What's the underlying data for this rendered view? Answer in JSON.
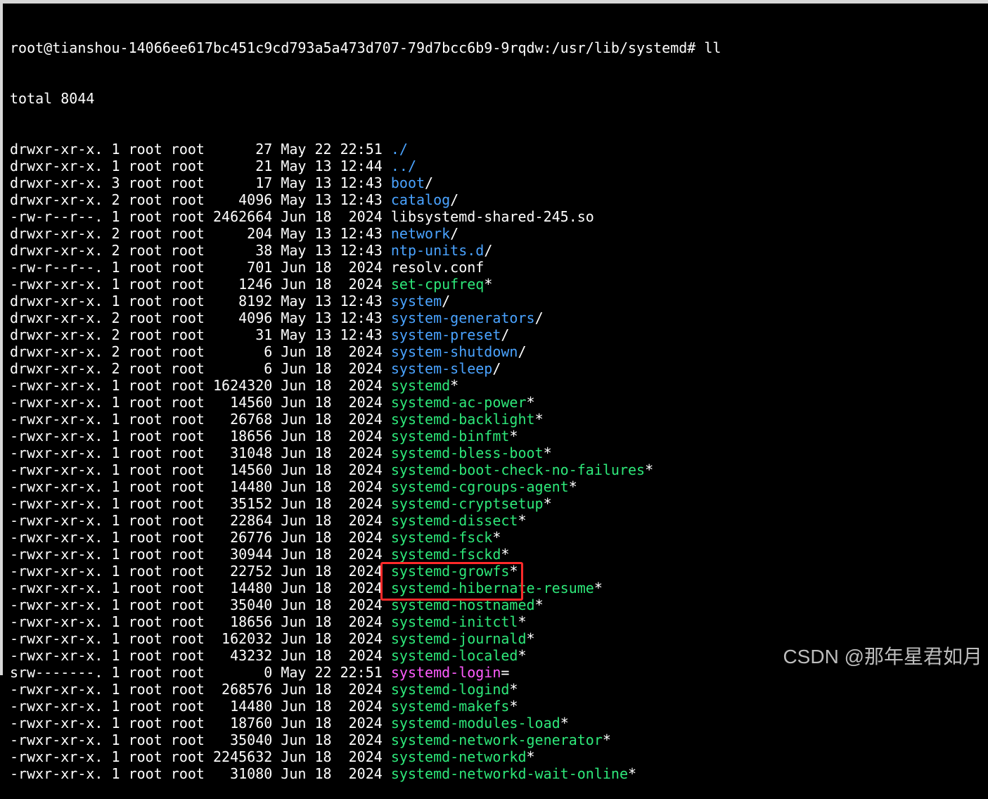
{
  "terminal": {
    "prompt": "root@tianshou-14066ee617bc451c9cd793a5a473d707-79d7bcc6b9-9rqdw:/usr/lib/systemd# ll",
    "total": "total 8044",
    "rows": [
      {
        "perms": "drwxr-xr-x.",
        "links": "1",
        "owner": "root",
        "group": "root",
        "size": "27",
        "month": "May",
        "day": "22",
        "time": "22:51",
        "name": "./",
        "type": "dir",
        "suffix": ""
      },
      {
        "perms": "drwxr-xr-x.",
        "links": "1",
        "owner": "root",
        "group": "root",
        "size": "21",
        "month": "May",
        "day": "13",
        "time": "12:44",
        "name": "../",
        "type": "dir",
        "suffix": ""
      },
      {
        "perms": "drwxr-xr-x.",
        "links": "3",
        "owner": "root",
        "group": "root",
        "size": "17",
        "month": "May",
        "day": "13",
        "time": "12:43",
        "name": "boot",
        "type": "dir",
        "suffix": "/"
      },
      {
        "perms": "drwxr-xr-x.",
        "links": "2",
        "owner": "root",
        "group": "root",
        "size": "4096",
        "month": "May",
        "day": "13",
        "time": "12:43",
        "name": "catalog",
        "type": "dir",
        "suffix": "/"
      },
      {
        "perms": "-rw-r--r--.",
        "links": "1",
        "owner": "root",
        "group": "root",
        "size": "2462664",
        "month": "Jun",
        "day": "18",
        "time": "2024",
        "name": "libsystemd-shared-245.so",
        "type": "plain",
        "suffix": ""
      },
      {
        "perms": "drwxr-xr-x.",
        "links": "2",
        "owner": "root",
        "group": "root",
        "size": "204",
        "month": "May",
        "day": "13",
        "time": "12:43",
        "name": "network",
        "type": "dir",
        "suffix": "/"
      },
      {
        "perms": "drwxr-xr-x.",
        "links": "2",
        "owner": "root",
        "group": "root",
        "size": "38",
        "month": "May",
        "day": "13",
        "time": "12:43",
        "name": "ntp-units.d",
        "type": "dir",
        "suffix": "/"
      },
      {
        "perms": "-rw-r--r--.",
        "links": "1",
        "owner": "root",
        "group": "root",
        "size": "701",
        "month": "Jun",
        "day": "18",
        "time": "2024",
        "name": "resolv.conf",
        "type": "plain",
        "suffix": ""
      },
      {
        "perms": "-rwxr-xr-x.",
        "links": "1",
        "owner": "root",
        "group": "root",
        "size": "1246",
        "month": "Jun",
        "day": "18",
        "time": "2024",
        "name": "set-cpufreq",
        "type": "exec",
        "suffix": "*"
      },
      {
        "perms": "drwxr-xr-x.",
        "links": "1",
        "owner": "root",
        "group": "root",
        "size": "8192",
        "month": "May",
        "day": "13",
        "time": "12:43",
        "name": "system",
        "type": "dir",
        "suffix": "/"
      },
      {
        "perms": "drwxr-xr-x.",
        "links": "2",
        "owner": "root",
        "group": "root",
        "size": "4096",
        "month": "May",
        "day": "13",
        "time": "12:43",
        "name": "system-generators",
        "type": "dir",
        "suffix": "/"
      },
      {
        "perms": "drwxr-xr-x.",
        "links": "2",
        "owner": "root",
        "group": "root",
        "size": "31",
        "month": "May",
        "day": "13",
        "time": "12:43",
        "name": "system-preset",
        "type": "dir",
        "suffix": "/"
      },
      {
        "perms": "drwxr-xr-x.",
        "links": "2",
        "owner": "root",
        "group": "root",
        "size": "6",
        "month": "Jun",
        "day": "18",
        "time": "2024",
        "name": "system-shutdown",
        "type": "dir",
        "suffix": "/"
      },
      {
        "perms": "drwxr-xr-x.",
        "links": "2",
        "owner": "root",
        "group": "root",
        "size": "6",
        "month": "Jun",
        "day": "18",
        "time": "2024",
        "name": "system-sleep",
        "type": "dir",
        "suffix": "/"
      },
      {
        "perms": "-rwxr-xr-x.",
        "links": "1",
        "owner": "root",
        "group": "root",
        "size": "1624320",
        "month": "Jun",
        "day": "18",
        "time": "2024",
        "name": "systemd",
        "type": "exec",
        "suffix": "*"
      },
      {
        "perms": "-rwxr-xr-x.",
        "links": "1",
        "owner": "root",
        "group": "root",
        "size": "14560",
        "month": "Jun",
        "day": "18",
        "time": "2024",
        "name": "systemd-ac-power",
        "type": "exec",
        "suffix": "*"
      },
      {
        "perms": "-rwxr-xr-x.",
        "links": "1",
        "owner": "root",
        "group": "root",
        "size": "26768",
        "month": "Jun",
        "day": "18",
        "time": "2024",
        "name": "systemd-backlight",
        "type": "exec",
        "suffix": "*"
      },
      {
        "perms": "-rwxr-xr-x.",
        "links": "1",
        "owner": "root",
        "group": "root",
        "size": "18656",
        "month": "Jun",
        "day": "18",
        "time": "2024",
        "name": "systemd-binfmt",
        "type": "exec",
        "suffix": "*"
      },
      {
        "perms": "-rwxr-xr-x.",
        "links": "1",
        "owner": "root",
        "group": "root",
        "size": "31048",
        "month": "Jun",
        "day": "18",
        "time": "2024",
        "name": "systemd-bless-boot",
        "type": "exec",
        "suffix": "*"
      },
      {
        "perms": "-rwxr-xr-x.",
        "links": "1",
        "owner": "root",
        "group": "root",
        "size": "14560",
        "month": "Jun",
        "day": "18",
        "time": "2024",
        "name": "systemd-boot-check-no-failures",
        "type": "exec",
        "suffix": "*"
      },
      {
        "perms": "-rwxr-xr-x.",
        "links": "1",
        "owner": "root",
        "group": "root",
        "size": "14480",
        "month": "Jun",
        "day": "18",
        "time": "2024",
        "name": "systemd-cgroups-agent",
        "type": "exec",
        "suffix": "*"
      },
      {
        "perms": "-rwxr-xr-x.",
        "links": "1",
        "owner": "root",
        "group": "root",
        "size": "35152",
        "month": "Jun",
        "day": "18",
        "time": "2024",
        "name": "systemd-cryptsetup",
        "type": "exec",
        "suffix": "*"
      },
      {
        "perms": "-rwxr-xr-x.",
        "links": "1",
        "owner": "root",
        "group": "root",
        "size": "22864",
        "month": "Jun",
        "day": "18",
        "time": "2024",
        "name": "systemd-dissect",
        "type": "exec",
        "suffix": "*"
      },
      {
        "perms": "-rwxr-xr-x.",
        "links": "1",
        "owner": "root",
        "group": "root",
        "size": "26776",
        "month": "Jun",
        "day": "18",
        "time": "2024",
        "name": "systemd-fsck",
        "type": "exec",
        "suffix": "*"
      },
      {
        "perms": "-rwxr-xr-x.",
        "links": "1",
        "owner": "root",
        "group": "root",
        "size": "30944",
        "month": "Jun",
        "day": "18",
        "time": "2024",
        "name": "systemd-fsckd",
        "type": "exec",
        "suffix": "*"
      },
      {
        "perms": "-rwxr-xr-x.",
        "links": "1",
        "owner": "root",
        "group": "root",
        "size": "22752",
        "month": "Jun",
        "day": "18",
        "time": "2024",
        "name": "systemd-growfs",
        "type": "exec",
        "suffix": "*"
      },
      {
        "perms": "-rwxr-xr-x.",
        "links": "1",
        "owner": "root",
        "group": "root",
        "size": "14480",
        "month": "Jun",
        "day": "18",
        "time": "2024",
        "name": "systemd-hibernate-resume",
        "type": "exec",
        "suffix": "*"
      },
      {
        "perms": "-rwxr-xr-x.",
        "links": "1",
        "owner": "root",
        "group": "root",
        "size": "35040",
        "month": "Jun",
        "day": "18",
        "time": "2024",
        "name": "systemd-hostnamed",
        "type": "exec",
        "suffix": "*"
      },
      {
        "perms": "-rwxr-xr-x.",
        "links": "1",
        "owner": "root",
        "group": "root",
        "size": "18656",
        "month": "Jun",
        "day": "18",
        "time": "2024",
        "name": "systemd-initctl",
        "type": "exec",
        "suffix": "*"
      },
      {
        "perms": "-rwxr-xr-x.",
        "links": "1",
        "owner": "root",
        "group": "root",
        "size": "162032",
        "month": "Jun",
        "day": "18",
        "time": "2024",
        "name": "systemd-journald",
        "type": "exec",
        "suffix": "*"
      },
      {
        "perms": "-rwxr-xr-x.",
        "links": "1",
        "owner": "root",
        "group": "root",
        "size": "43232",
        "month": "Jun",
        "day": "18",
        "time": "2024",
        "name": "systemd-localed",
        "type": "exec",
        "suffix": "*"
      },
      {
        "perms": "srw-------.",
        "links": "1",
        "owner": "root",
        "group": "root",
        "size": "0",
        "month": "May",
        "day": "22",
        "time": "22:51",
        "name": "systemd-login",
        "type": "sock",
        "suffix": "="
      },
      {
        "perms": "-rwxr-xr-x.",
        "links": "1",
        "owner": "root",
        "group": "root",
        "size": "268576",
        "month": "Jun",
        "day": "18",
        "time": "2024",
        "name": "systemd-logind",
        "type": "exec",
        "suffix": "*"
      },
      {
        "perms": "-rwxr-xr-x.",
        "links": "1",
        "owner": "root",
        "group": "root",
        "size": "14480",
        "month": "Jun",
        "day": "18",
        "time": "2024",
        "name": "systemd-makefs",
        "type": "exec",
        "suffix": "*"
      },
      {
        "perms": "-rwxr-xr-x.",
        "links": "1",
        "owner": "root",
        "group": "root",
        "size": "18760",
        "month": "Jun",
        "day": "18",
        "time": "2024",
        "name": "systemd-modules-load",
        "type": "exec",
        "suffix": "*"
      },
      {
        "perms": "-rwxr-xr-x.",
        "links": "1",
        "owner": "root",
        "group": "root",
        "size": "35040",
        "month": "Jun",
        "day": "18",
        "time": "2024",
        "name": "systemd-network-generator",
        "type": "exec",
        "suffix": "*"
      },
      {
        "perms": "-rwxr-xr-x.",
        "links": "1",
        "owner": "root",
        "group": "root",
        "size": "2245632",
        "month": "Jun",
        "day": "18",
        "time": "2024",
        "name": "systemd-networkd",
        "type": "exec",
        "suffix": "*"
      },
      {
        "perms": "-rwxr-xr-x.",
        "links": "1",
        "owner": "root",
        "group": "root",
        "size": "31080",
        "month": "Jun",
        "day": "18",
        "time": "2024",
        "name": "systemd-networkd-wait-online",
        "type": "exec",
        "suffix": "*"
      }
    ]
  },
  "watermark": "CSDN @那年星君如月",
  "colors": {
    "background": "#000000",
    "text": "#ffffff",
    "directory": "#4aa3ff",
    "executable": "#2ee87a",
    "socket": "#ff5cff",
    "highlight_box": "#ff2a2a"
  }
}
